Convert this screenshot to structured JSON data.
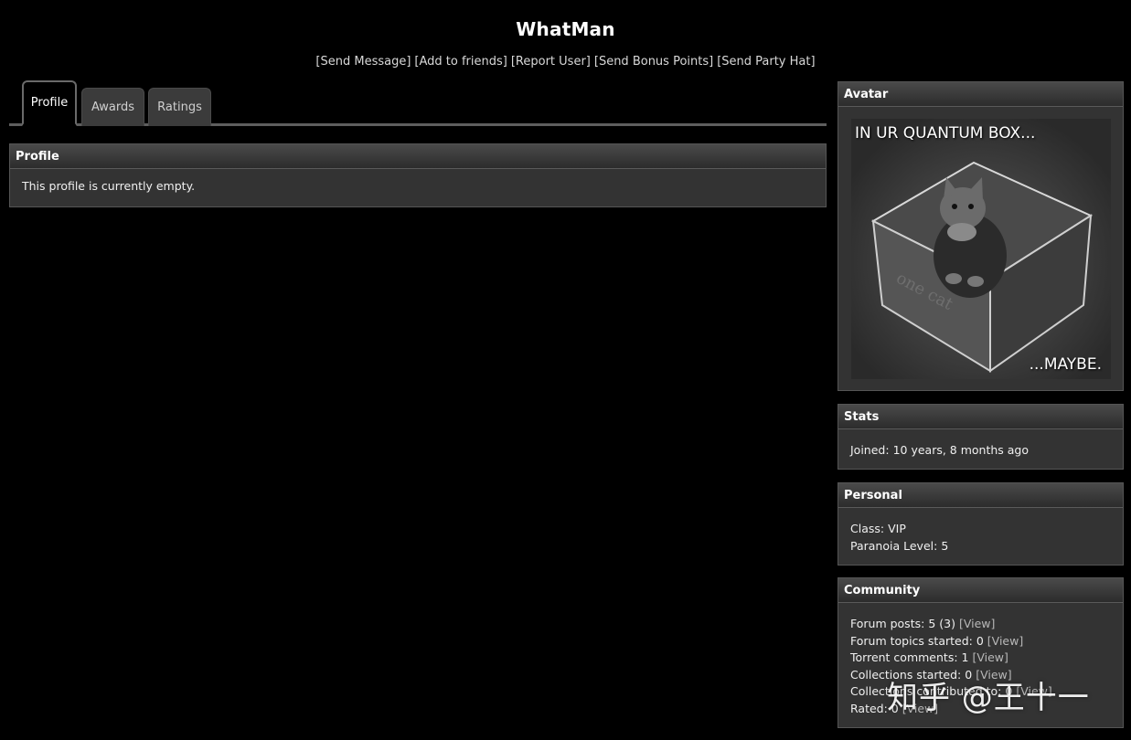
{
  "page": {
    "username": "WhatMan"
  },
  "actions": [
    "[Send Message]",
    "[Add to friends]",
    "[Report User]",
    "[Send Bonus Points]",
    "[Send Party Hat]"
  ],
  "tabs": [
    {
      "label": "Profile",
      "active": true
    },
    {
      "label": "Awards",
      "active": false
    },
    {
      "label": "Ratings",
      "active": false
    }
  ],
  "profile": {
    "heading": "Profile",
    "text": "This profile is currently empty."
  },
  "avatar": {
    "heading": "Avatar",
    "caption_top": "IN UR QUANTUM BOX...",
    "caption_bottom": "...MAYBE.",
    "box_text": "one cat"
  },
  "stats": {
    "heading": "Stats",
    "joined_label": "Joined:",
    "joined_value": "10 years, 8 months ago"
  },
  "personal": {
    "heading": "Personal",
    "class_label": "Class:",
    "class_value": "VIP",
    "paranoia_label": "Paranoia Level:",
    "paranoia_value": "5"
  },
  "community": {
    "heading": "Community",
    "view_label": "[View]",
    "rows": [
      {
        "label": "Forum posts:",
        "value": "5 (3)"
      },
      {
        "label": "Forum topics started:",
        "value": "0"
      },
      {
        "label": "Torrent comments:",
        "value": "1"
      },
      {
        "label": "Collections started:",
        "value": "0"
      },
      {
        "label": "Collections contributed to:",
        "value": "0"
      },
      {
        "label": "Rated:",
        "value": "0"
      }
    ]
  },
  "watermark": "知乎 @王十一"
}
